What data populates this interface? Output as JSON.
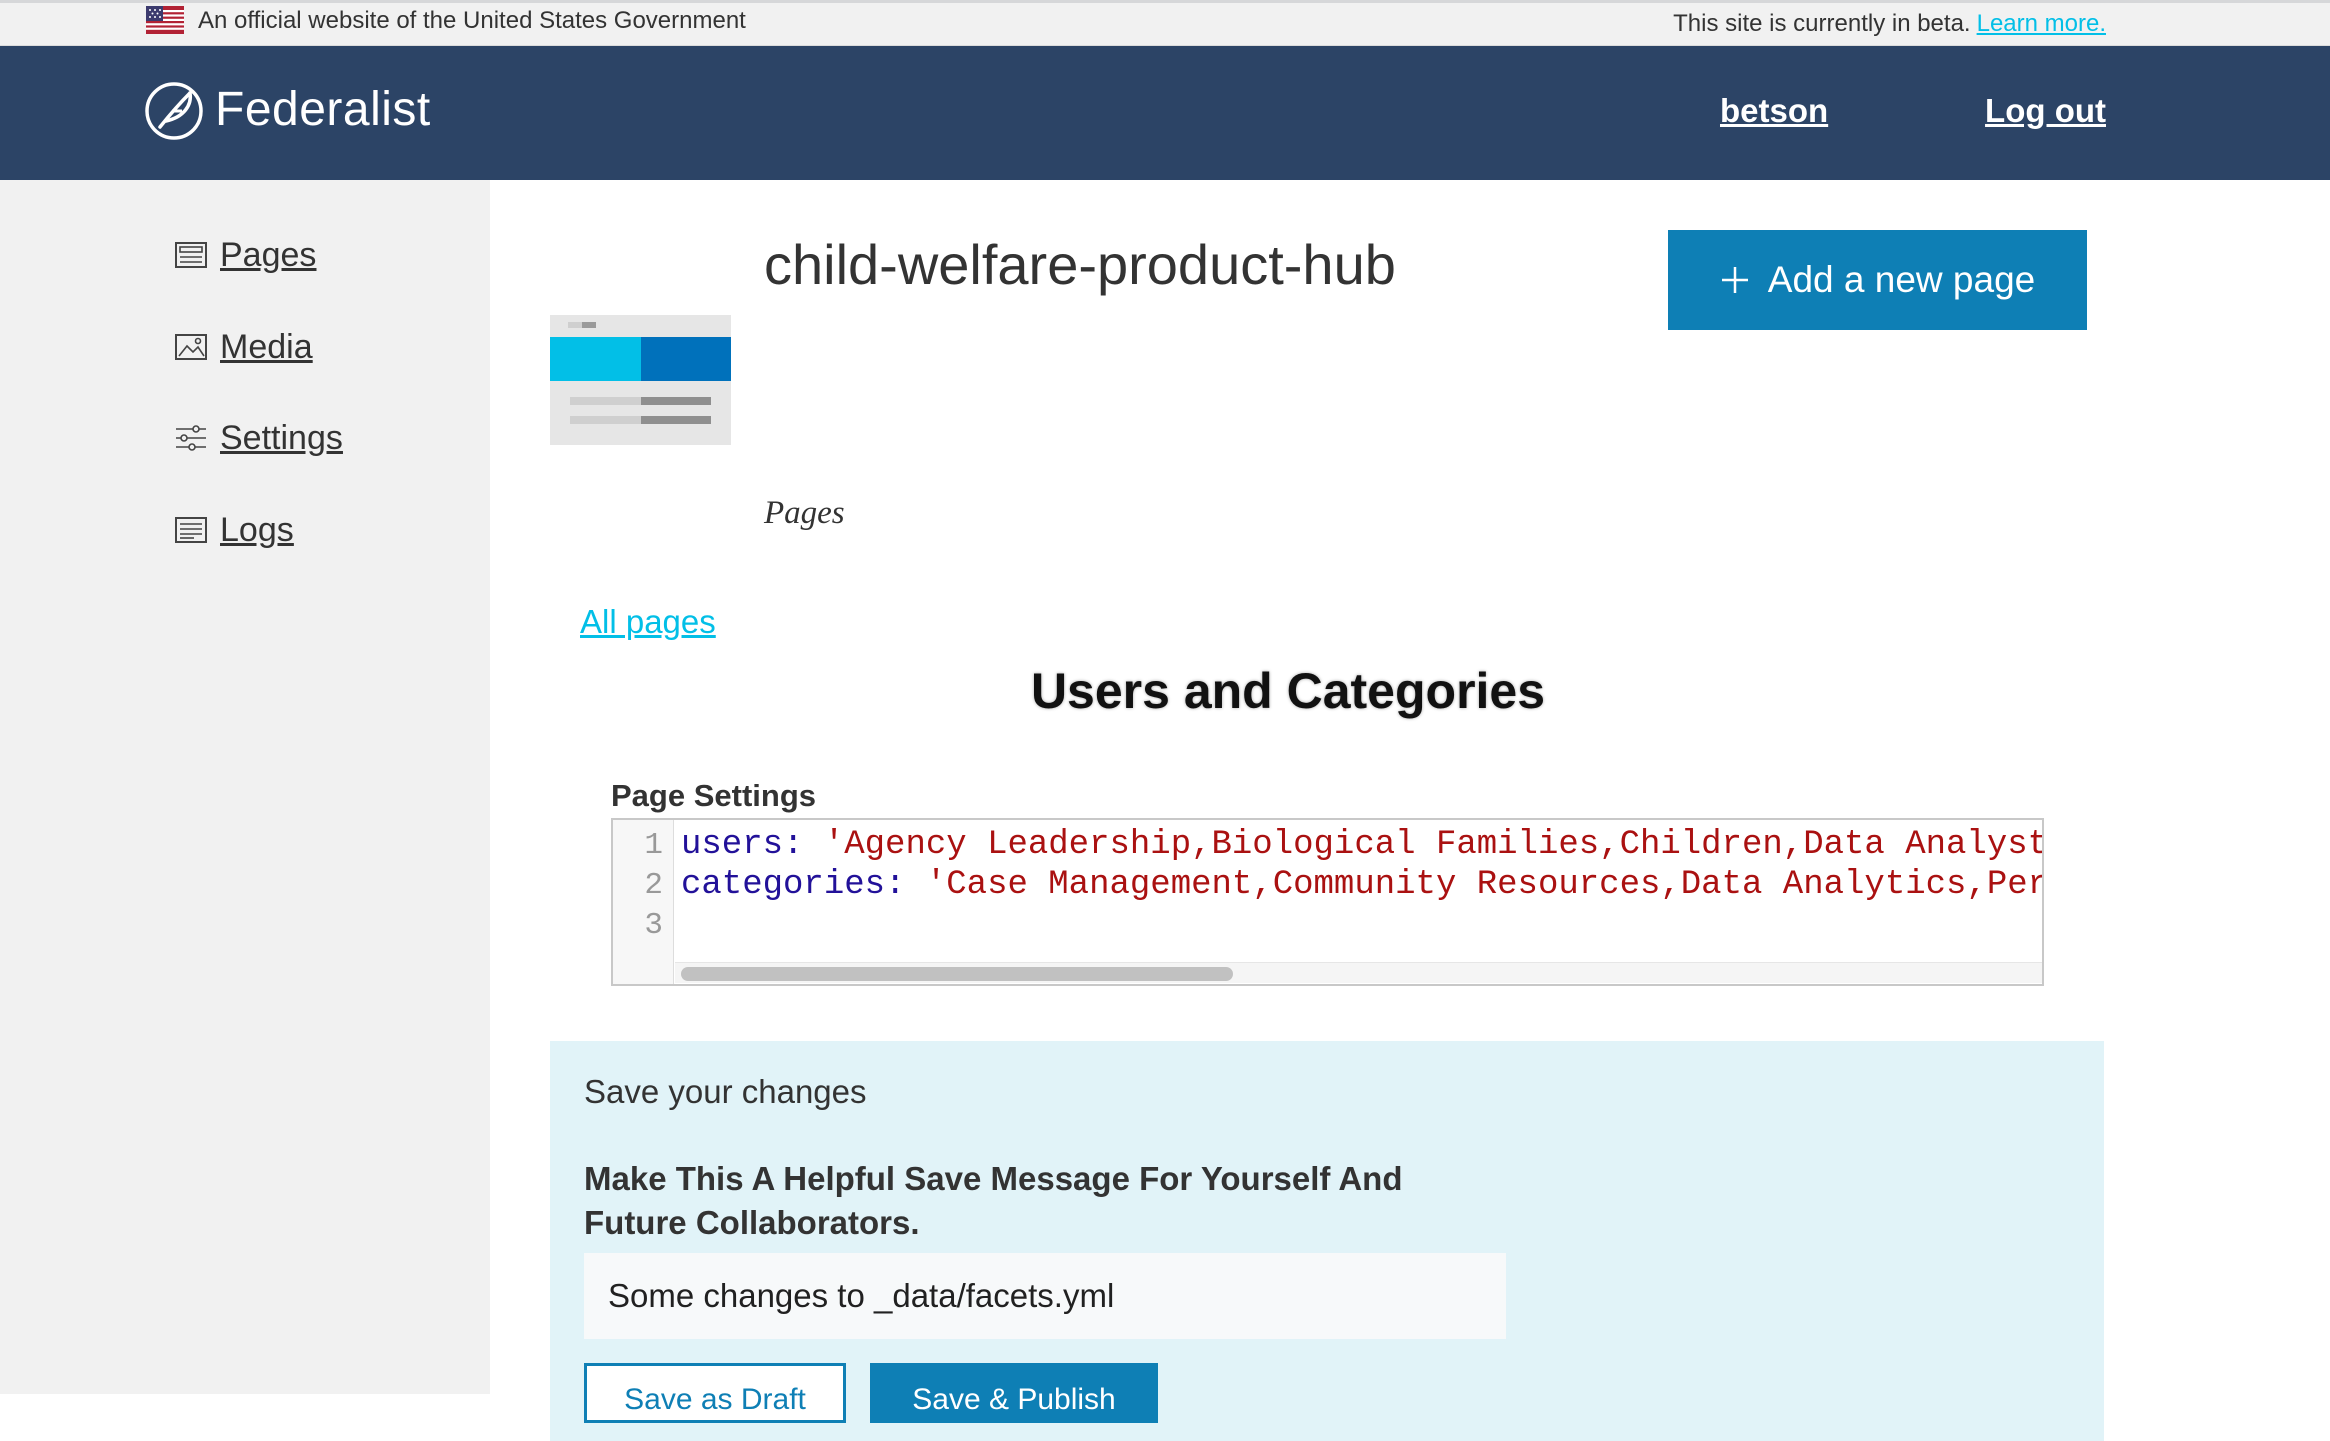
{
  "banner": {
    "gov_text": "An official website of the United States Government",
    "beta_text": "This site is currently in beta.",
    "beta_link": "Learn more."
  },
  "header": {
    "brand": "Federalist",
    "user": "betson",
    "logout": "Log out"
  },
  "sidebar": {
    "items": [
      {
        "label": "Pages",
        "icon": "pages-icon"
      },
      {
        "label": "Media",
        "icon": "media-icon"
      },
      {
        "label": "Settings",
        "icon": "settings-sliders-icon"
      },
      {
        "label": "Logs",
        "icon": "logs-icon"
      }
    ]
  },
  "main": {
    "site_title": "child-welfare-product-hub",
    "add_button": "Add a new page",
    "section_label": "Pages",
    "all_pages_link": "All pages",
    "page_heading": "Users and Categories",
    "settings_label": "Page Settings",
    "editor": {
      "line_numbers": [
        "1",
        "2",
        "3"
      ],
      "lines": [
        {
          "key": "users",
          "punct": ":",
          "value": " 'Agency Leadership,Biological Families,Children,Data Analyst"
        },
        {
          "key": "categories",
          "punct": ":",
          "value": " 'Case Management,Community Resources,Data Analytics,Per"
        },
        {
          "key": "",
          "punct": "",
          "value": ""
        }
      ]
    }
  },
  "save": {
    "title": "Save your changes",
    "message_label": "Make This A Helpful Save Message For Yourself And Future Collaborators.",
    "message_value": "Some changes to _data/facets.yml",
    "draft_button": "Save as Draft",
    "publish_button": "Save & Publish"
  },
  "colors": {
    "header_bg": "#2c4466",
    "accent": "#0e7fb5",
    "link": "#02bfe7",
    "sidebar_bg": "#f1f1f1",
    "save_panel_bg": "#e1f3f8"
  }
}
